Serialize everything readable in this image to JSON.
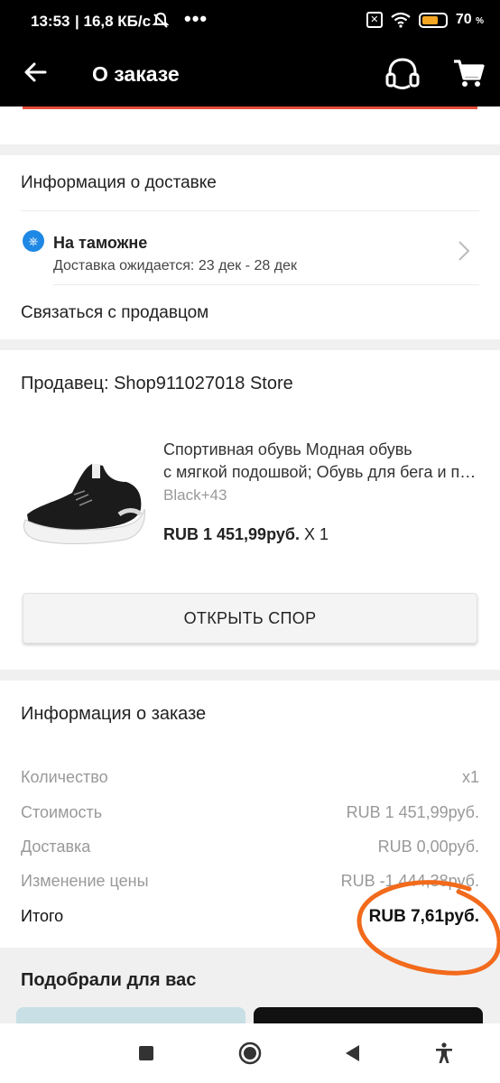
{
  "status_bar": {
    "time": "13:53",
    "speed": "16,8 КБ/с",
    "dots": "•••",
    "sim_glyph": "✕",
    "battery_percent": "70",
    "battery_unit": "%",
    "battery_level": 0.7,
    "battery_color": "#f5a623"
  },
  "header": {
    "title": "О заказе",
    "back_icon": "arrow-left-icon",
    "support_icon": "headset-icon",
    "cart_icon": "cart-icon"
  },
  "delivery": {
    "heading": "Информация о доставке",
    "status_title": "На таможне",
    "status_subtitle": "Доставка ожидается: 23 дек - 28 дек",
    "status_icon": "ship-wheel-icon",
    "contact_seller": "Связаться с продавцом",
    "accent_color": "#1e88e5"
  },
  "seller": {
    "name": "Продавец: Shop911027018 Store",
    "product": {
      "title_line1": "Спортивная обувь Модная обувь",
      "title_line2": "с мягкой подошвой; Обувь для бега и прогулок",
      "variant": "Black+43",
      "price": "RUB 1 451,99руб.",
      "quantity": " X 1"
    },
    "dispute_button": "ОТКРЫТЬ СПОР"
  },
  "order_info": {
    "heading": "Информация о заказе",
    "rows": [
      {
        "label": "Количество",
        "value": "x1"
      },
      {
        "label": "Стоимость",
        "value": "RUB 1 451,99руб."
      },
      {
        "label": "Доставка",
        "value": "RUB 0,00руб."
      },
      {
        "label": "Изменение цены",
        "value": "RUB -1 444,38руб."
      }
    ],
    "total": {
      "label": "Итого",
      "value": "RUB 7,61руб."
    },
    "annotation_color": "#f26a1b"
  },
  "recommendations": {
    "heading": "Подобрали для вас"
  },
  "nav_bar": {
    "recent_icon": "square-icon",
    "home_icon": "circle-icon",
    "back_icon": "triangle-back-icon",
    "accessibility_icon": "accessibility-icon"
  }
}
